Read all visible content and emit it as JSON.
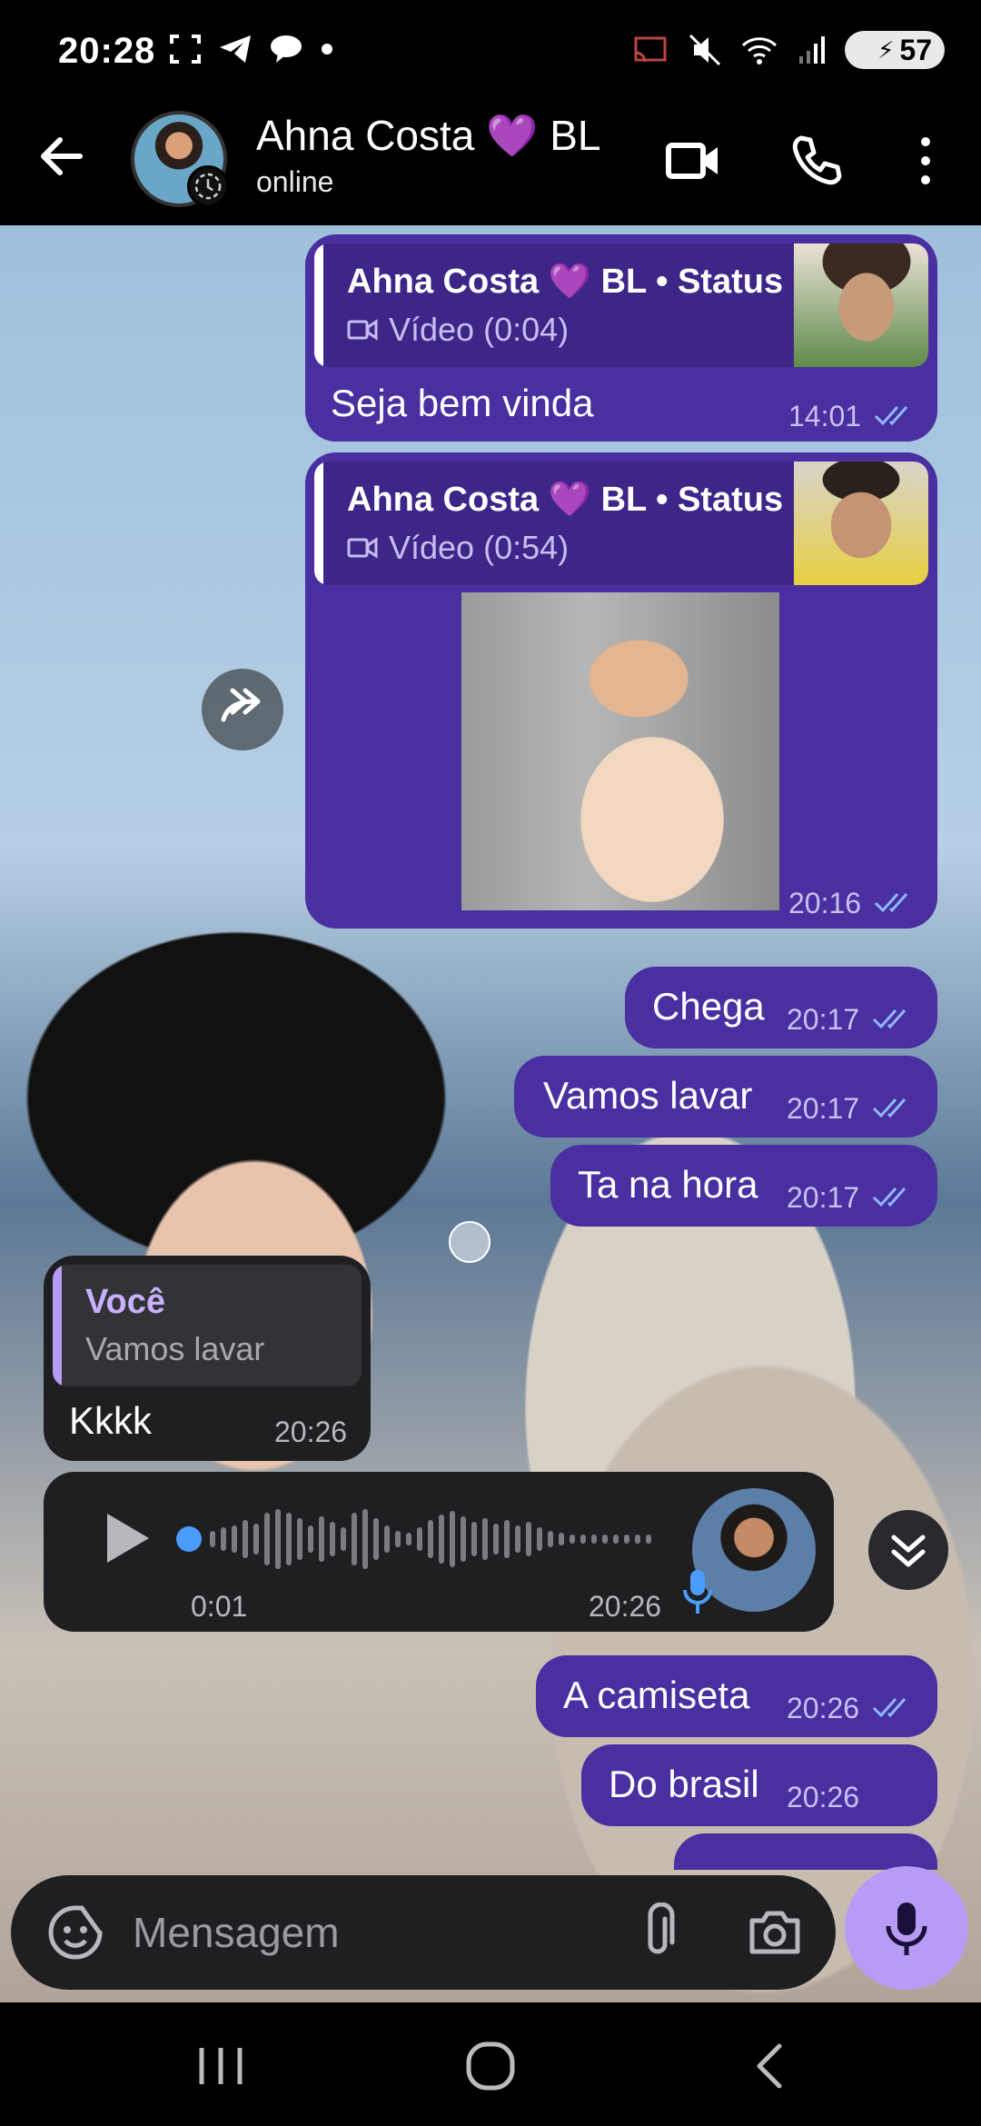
{
  "status_bar": {
    "time": "20:28",
    "battery": "57"
  },
  "header": {
    "contact_name": "Ahna Costa 💜 BL",
    "contact_status": "online"
  },
  "messages": {
    "m1": {
      "reply_title": "Ahna Costa 💜 BL • Status",
      "reply_sub": "Vídeo (0:04)",
      "text": "Seja bem vinda",
      "time": "14:01"
    },
    "m2": {
      "reply_title": "Ahna Costa 💜 BL • Status",
      "reply_sub": "Vídeo (0:54)",
      "time": "20:16"
    },
    "m3": {
      "text": "Chega",
      "time": "20:17"
    },
    "m4": {
      "text": "Vamos lavar",
      "time": "20:17"
    },
    "m5": {
      "text": "Ta na hora",
      "time": "20:17"
    },
    "m6": {
      "reply_title": "Você",
      "reply_sub": "Vamos lavar",
      "text": "Kkkk",
      "time": "20:26"
    },
    "voice": {
      "elapsed": "0:01",
      "time": "20:26"
    },
    "m8": {
      "text": "A camiseta",
      "time": "20:26"
    },
    "m9": {
      "text": "Do brasil",
      "time": "20:26"
    }
  },
  "input": {
    "placeholder": "Mensagem"
  },
  "colors": {
    "outgoing": "#4a2fa0",
    "incoming": "#1f1f22",
    "accent": "#b79cf5",
    "ticks": "#8fb8ff"
  },
  "icons": [
    "back-arrow",
    "video-call",
    "phone",
    "more-vertical",
    "forward",
    "play",
    "mic",
    "sticker",
    "attach",
    "camera",
    "double-chevron-down"
  ]
}
